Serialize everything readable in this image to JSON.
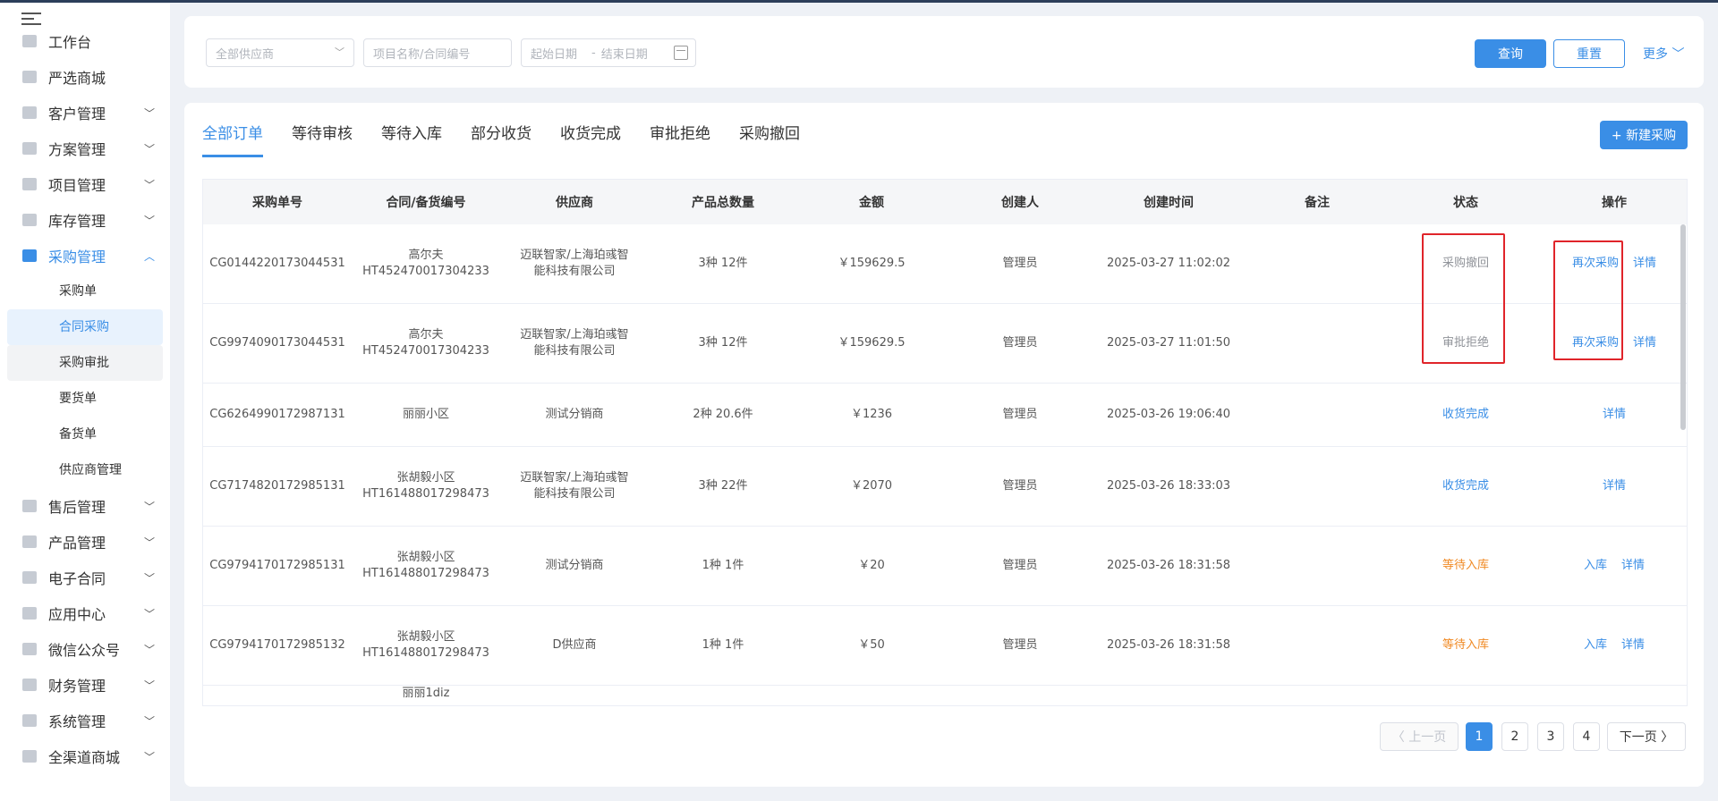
{
  "sidebar": {
    "items": [
      {
        "label": "工作台",
        "icon": "home-icon",
        "chevron": ""
      },
      {
        "label": "严选商城",
        "icon": "mall-icon",
        "chevron": ""
      },
      {
        "label": "客户管理",
        "icon": "customer-icon",
        "chevron": "﹀"
      },
      {
        "label": "方案管理",
        "icon": "plan-icon",
        "chevron": "﹀"
      },
      {
        "label": "项目管理",
        "icon": "folder-icon",
        "chevron": "﹀"
      },
      {
        "label": "库存管理",
        "icon": "inventory-icon",
        "chevron": "﹀"
      },
      {
        "label": "采购管理",
        "icon": "cart-icon",
        "chevron": "︿"
      },
      {
        "label": "售后管理",
        "icon": "headset-icon",
        "chevron": "﹀"
      },
      {
        "label": "产品管理",
        "icon": "box-icon",
        "chevron": "﹀"
      },
      {
        "label": "电子合同",
        "icon": "contract-icon",
        "chevron": "﹀"
      },
      {
        "label": "应用中心",
        "icon": "apps-icon",
        "chevron": "﹀"
      },
      {
        "label": "微信公众号",
        "icon": "wechat-icon",
        "chevron": "﹀"
      },
      {
        "label": "财务管理",
        "icon": "finance-icon",
        "chevron": "﹀"
      },
      {
        "label": "系统管理",
        "icon": "settings-icon",
        "chevron": "﹀"
      },
      {
        "label": "全渠道商城",
        "icon": "store-icon",
        "chevron": "﹀"
      }
    ],
    "sub_items": [
      "采购单",
      "合同采购",
      "采购审批",
      "要货单",
      "备货单",
      "供应商管理"
    ]
  },
  "filters": {
    "supplier": "全部供应商",
    "project": "项目名称/合同编号",
    "start_date": "起始日期",
    "date_sep": "-",
    "end_date": "结束日期",
    "query": "查询",
    "reset": "重置",
    "more": "更多 ﹀"
  },
  "tabs": [
    "全部订单",
    "等待审核",
    "等待入库",
    "部分收货",
    "收货完成",
    "审批拒绝",
    "采购撤回"
  ],
  "new_button": "+ 新建采购",
  "table": {
    "headers": [
      "采购单号",
      "合同/备货编号",
      "供应商",
      "产品总数量",
      "金额",
      "创建人",
      "创建时间",
      "备注",
      "状态",
      "操作"
    ],
    "rows": [
      {
        "no": "CG0144220173044531",
        "contract": "高尔夫\nHT452470017304233",
        "supplier": "迈联智家/上海珀彧智能科技有限公司",
        "qty": "3种 12件",
        "amount": "￥159629.5",
        "creator": "管理员",
        "time": "2025-03-27 11:02:02",
        "note": "",
        "status": "采购撤回",
        "ops": [
          "再次采购",
          "详情"
        ]
      },
      {
        "no": "CG9974090173044531",
        "contract": "高尔夫\nHT452470017304233",
        "supplier": "迈联智家/上海珀彧智能科技有限公司",
        "qty": "3种 12件",
        "amount": "￥159629.5",
        "creator": "管理员",
        "time": "2025-03-27 11:01:50",
        "note": "",
        "status": "审批拒绝",
        "ops": [
          "再次采购",
          "详情"
        ]
      },
      {
        "no": "CG6264990172987131",
        "contract": "丽丽小区",
        "supplier": "测试分销商",
        "qty": "2种 20.6件",
        "amount": "￥1236",
        "creator": "管理员",
        "time": "2025-03-26 19:06:40",
        "note": "",
        "status": "收货完成",
        "ops": [
          "详情"
        ]
      },
      {
        "no": "CG7174820172985131",
        "contract": "张胡毅小区\nHT161488017298473",
        "supplier": "迈联智家/上海珀彧智能科技有限公司",
        "qty": "3种 22件",
        "amount": "￥2070",
        "creator": "管理员",
        "time": "2025-03-26 18:33:03",
        "note": "",
        "status": "收货完成",
        "ops": [
          "详情"
        ]
      },
      {
        "no": "CG9794170172985131",
        "contract": "张胡毅小区\nHT161488017298473",
        "supplier": "测试分销商",
        "qty": "1种 1件",
        "amount": "￥20",
        "creator": "管理员",
        "time": "2025-03-26 18:31:58",
        "note": "",
        "status": "等待入库",
        "ops": [
          "入库",
          "详情"
        ]
      },
      {
        "no": "CG9794170172985132",
        "contract": "张胡毅小区\nHT161488017298473",
        "supplier": "D供应商",
        "qty": "1种 1件",
        "amount": "￥50",
        "creator": "管理员",
        "time": "2025-03-26 18:31:58",
        "note": "",
        "status": "等待入库",
        "ops": [
          "入库",
          "详情"
        ]
      },
      {
        "no": "",
        "contract": "丽丽1diz",
        "supplier": "",
        "qty": "",
        "amount": "",
        "creator": "",
        "time": "",
        "note": "",
        "status": "",
        "ops": []
      }
    ]
  },
  "pagination": {
    "prev": "〈 上一页",
    "pages": [
      "1",
      "2",
      "3",
      "4"
    ],
    "current": "1",
    "next": "下一页 〉"
  },
  "colors": {
    "accent": "#3a8ee6",
    "highlight_box": "#e0242a",
    "orange": "#f08a24"
  }
}
